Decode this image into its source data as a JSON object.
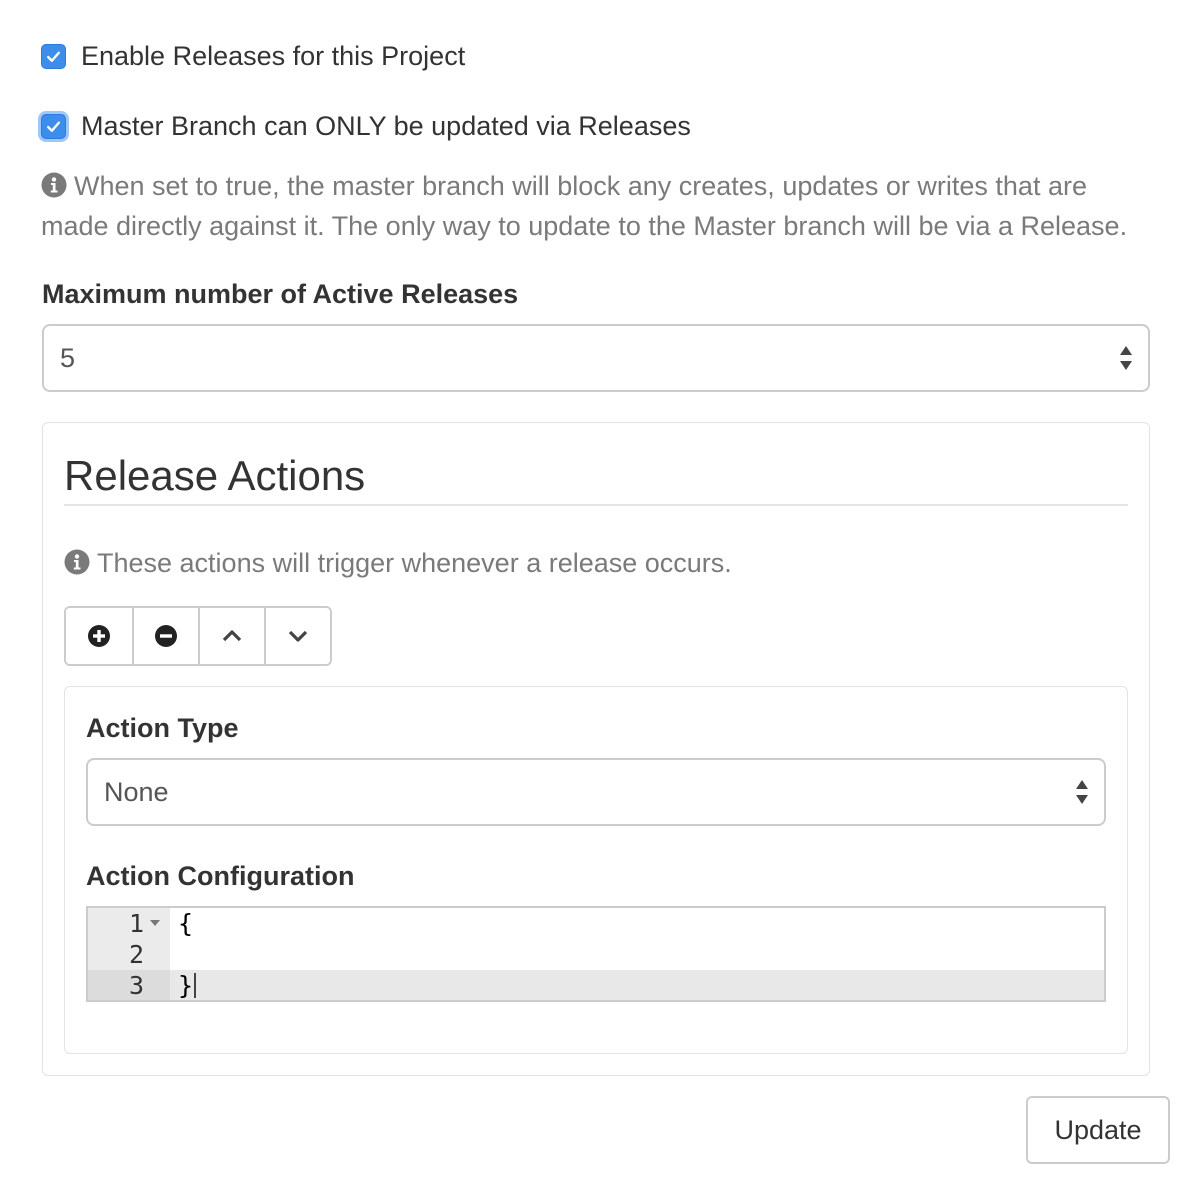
{
  "checkboxes": {
    "enable_releases": {
      "label": "Enable Releases for this Project",
      "checked": true
    },
    "master_only": {
      "label": "Master Branch can ONLY be updated via Releases",
      "checked": true
    }
  },
  "master_help": "When set to true, the master branch will block any creates, updates or writes that are made directly against it. The only way to update to the Master branch will be via a Release.",
  "max_active": {
    "label": "Maximum number of Active Releases",
    "value": "5"
  },
  "release_actions": {
    "title": "Release Actions",
    "help": "These actions will trigger whenever a release occurs.",
    "toolbar": [
      "add-icon",
      "remove-icon",
      "move-up-icon",
      "move-down-icon"
    ],
    "action_type": {
      "label": "Action Type",
      "value": "None"
    },
    "action_config": {
      "label": "Action Configuration",
      "lines": [
        {
          "num": "1",
          "code": "{"
        },
        {
          "num": "2",
          "code": ""
        },
        {
          "num": "3",
          "code": "}"
        }
      ]
    }
  },
  "update_button": "Update",
  "colors": {
    "checkbox": "#3d8eea",
    "help_text": "#7a7a7a"
  }
}
